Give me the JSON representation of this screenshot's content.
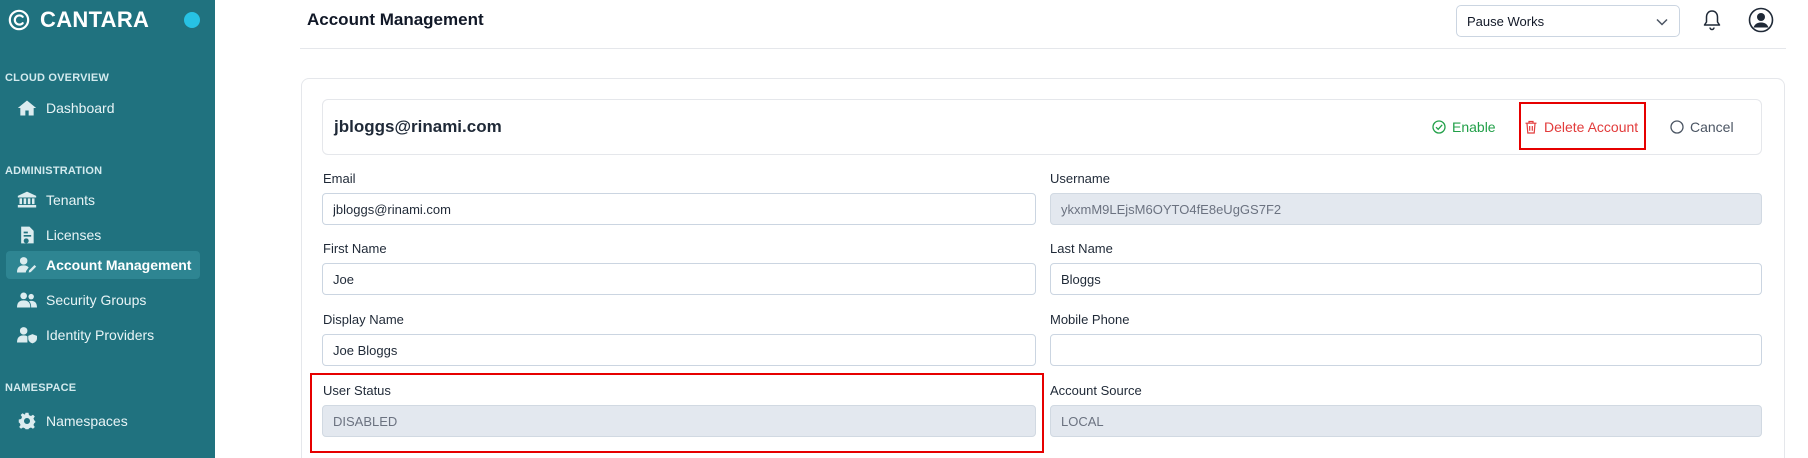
{
  "brand": {
    "name": "CANTARA"
  },
  "sidebar": {
    "sections": [
      {
        "label": "CLOUD OVERVIEW"
      },
      {
        "label": "ADMINISTRATION"
      },
      {
        "label": "NAMESPACE"
      }
    ],
    "items": [
      {
        "label": "Dashboard",
        "icon": "home-icon"
      },
      {
        "label": "Tenants",
        "icon": "building-icon"
      },
      {
        "label": "Licenses",
        "icon": "license-icon"
      },
      {
        "label": "Account Management",
        "icon": "user-edit-icon",
        "active": true
      },
      {
        "label": "Security Groups",
        "icon": "users-icon"
      },
      {
        "label": "Identity Providers",
        "icon": "user-shield-icon"
      },
      {
        "label": "Namespaces",
        "icon": "gear-icon"
      }
    ]
  },
  "header": {
    "title": "Account Management",
    "select_value": "Pause Works"
  },
  "account": {
    "title": "jbloggs@rinami.com",
    "actions": {
      "enable": "Enable",
      "delete": "Delete Account",
      "cancel": "Cancel"
    }
  },
  "form": {
    "email": {
      "label": "Email",
      "value": "jbloggs@rinami.com"
    },
    "username": {
      "label": "Username",
      "value": "ykxmM9LEjsM6OYTO4fE8eUgGS7F2"
    },
    "first_name": {
      "label": "First Name",
      "value": "Joe"
    },
    "last_name": {
      "label": "Last Name",
      "value": "Bloggs"
    },
    "display_name": {
      "label": "Display Name",
      "value": "Joe Bloggs"
    },
    "mobile_phone": {
      "label": "Mobile Phone",
      "value": ""
    },
    "user_status": {
      "label": "User Status",
      "value": "DISABLED"
    },
    "account_source": {
      "label": "Account Source",
      "value": "LOCAL"
    }
  },
  "colors": {
    "sidebar_bg": "#20727f",
    "active_item_bg": "#2e8592",
    "status_dot": "#27c2e4",
    "enable": "#22a049",
    "delete": "#e23b3b",
    "highlight": "#e60000",
    "readonly_bg": "#e3e8ef"
  }
}
